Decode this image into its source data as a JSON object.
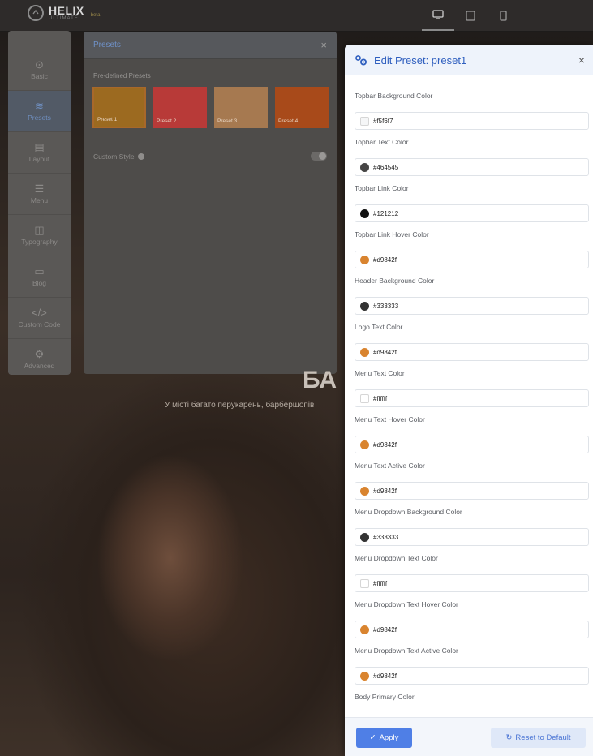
{
  "app": {
    "logo_text": "HELIX",
    "logo_sub": "ULTIMATE",
    "logo_badge": "beta"
  },
  "devices": [
    {
      "name": "desktop-icon",
      "glyph": "▭"
    },
    {
      "name": "tablet-icon",
      "glyph": "▯"
    },
    {
      "name": "mobile-icon",
      "glyph": "▯"
    }
  ],
  "sidebar": {
    "top_label": "...",
    "items": [
      {
        "label": "Basic",
        "icon": "⊙"
      },
      {
        "label": "Presets",
        "icon": "≋"
      },
      {
        "label": "Layout",
        "icon": "▤"
      },
      {
        "label": "Menu",
        "icon": "☰"
      },
      {
        "label": "Typography",
        "icon": "◫"
      },
      {
        "label": "Blog",
        "icon": "▭"
      },
      {
        "label": "Custom Code",
        "icon": "</>"
      },
      {
        "label": "Advanced",
        "icon": "⚙"
      }
    ],
    "active_index": 1
  },
  "presets_panel": {
    "title": "Presets",
    "close": "×",
    "section_label": "Pre-defined Presets",
    "presets": [
      {
        "label": "Preset 1",
        "color": "#9c6a20"
      },
      {
        "label": "Preset 2",
        "color": "#b83a38"
      },
      {
        "label": "Preset 3",
        "color": "#a67950"
      },
      {
        "label": "Preset 4",
        "color": "#a84a1a"
      }
    ],
    "selected_index": 0,
    "custom_style_label": "Custom Style",
    "custom_style_enabled": false
  },
  "hero": {
    "title": "БА",
    "subtitle": "У місті багато перукарень, барбершопів"
  },
  "edit_panel": {
    "title": "Edit Preset: preset1",
    "close": "×",
    "fields": [
      {
        "label": "Topbar Background Color",
        "value": "#f5f6f7",
        "swatch": "#f5f6f7",
        "light": true
      },
      {
        "label": "Topbar Text Color",
        "value": "#464545",
        "swatch": "#464545",
        "light": false
      },
      {
        "label": "Topbar Link Color",
        "value": "#121212",
        "swatch": "#121212",
        "light": false
      },
      {
        "label": "Topbar Link Hover Color",
        "value": "#d9842f",
        "swatch": "#d9842f",
        "light": false
      },
      {
        "label": "Header Background Color",
        "value": "#333333",
        "swatch": "#333333",
        "light": false
      },
      {
        "label": "Logo Text Color",
        "value": "#d9842f",
        "swatch": "#d9842f",
        "light": false
      },
      {
        "label": "Menu Text Color",
        "value": "#ffffff",
        "swatch": "#ffffff",
        "light": true
      },
      {
        "label": "Menu Text Hover Color",
        "value": "#d9842f",
        "swatch": "#d9842f",
        "light": false
      },
      {
        "label": "Menu Text Active Color",
        "value": "#d9842f",
        "swatch": "#d9842f",
        "light": false
      },
      {
        "label": "Menu Dropdown Background Color",
        "value": "#333333",
        "swatch": "#333333",
        "light": false
      },
      {
        "label": "Menu Dropdown Text Color",
        "value": "#ffffff",
        "swatch": "#ffffff",
        "light": true
      },
      {
        "label": "Menu Dropdown Text Hover Color",
        "value": "#d9842f",
        "swatch": "#d9842f",
        "light": false
      },
      {
        "label": "Menu Dropdown Text Active Color",
        "value": "#d9842f",
        "swatch": "#d9842f",
        "light": false
      },
      {
        "label": "Body Primary Color",
        "value": "",
        "swatch": "",
        "light": false
      }
    ],
    "apply_label": "Apply",
    "reset_label": "Reset to Default"
  }
}
